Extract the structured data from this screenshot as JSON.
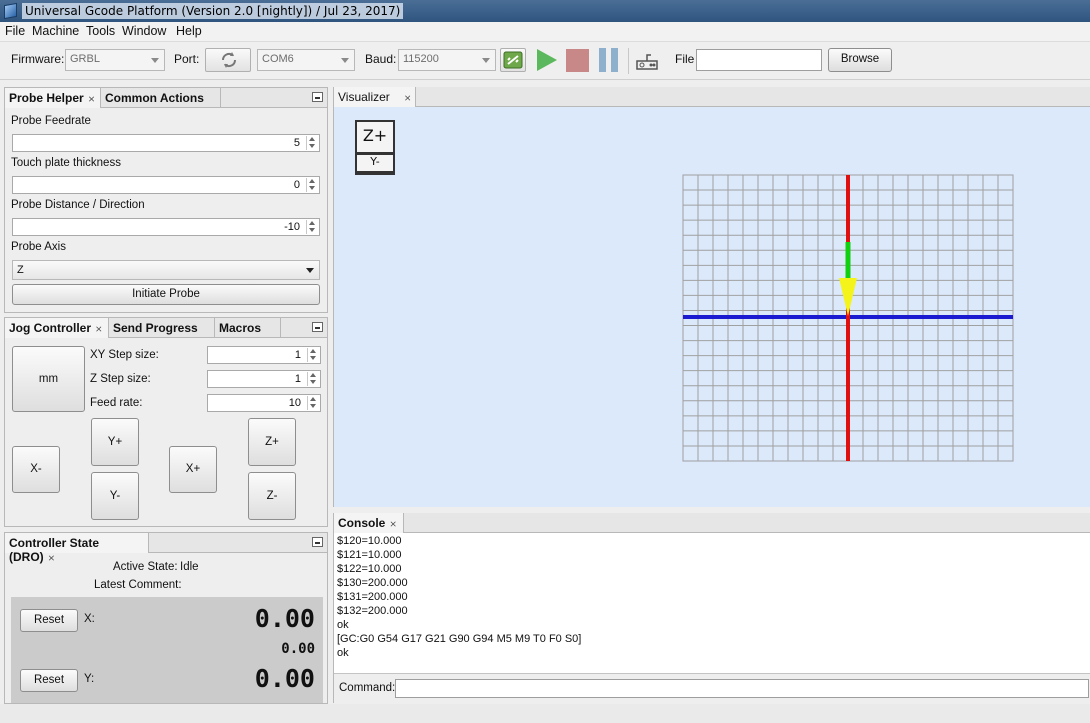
{
  "window": {
    "title": "Universal Gcode Platform (Version 2.0 [nightly])  / Jul 23, 2017)"
  },
  "menu": [
    "File",
    "Machine",
    "Tools",
    "Window",
    "Help"
  ],
  "toolbar": {
    "firmware_label": "Firmware:",
    "firmware_value": "GRBL",
    "port_label": "Port:",
    "port_value": "COM6",
    "baud_label": "Baud:",
    "baud_value": "115200",
    "file_label": "File",
    "file_value": "",
    "browse_label": "Browse",
    "colors": {
      "play": "#5cb85c",
      "stop": "#c98888",
      "pause": "#8fb0cc"
    }
  },
  "probe": {
    "tabs": [
      "Probe Helper",
      "Common Actions"
    ],
    "feedrate_label": "Probe Feedrate",
    "feedrate_value": "5",
    "thickness_label": "Touch plate thickness",
    "thickness_value": "0",
    "distance_label": "Probe Distance / Direction",
    "distance_value": "-10",
    "axis_label": "Probe Axis",
    "axis_value": "Z",
    "initiate_label": "Initiate Probe"
  },
  "jog": {
    "tabs": [
      "Jog Controller",
      "Send Progress",
      "Macros"
    ],
    "unit_label": "mm",
    "xy_label": "XY Step size:",
    "xy_value": "1",
    "z_label": "Z Step size:",
    "z_value": "1",
    "feed_label": "Feed rate:",
    "feed_value": "10",
    "buttons": {
      "xminus": "X-",
      "yplus": "Y+",
      "yminus": "Y-",
      "xplus": "X+",
      "zplus": "Z+",
      "zminus": "Z-"
    }
  },
  "dro": {
    "title": "Controller State (DRO)",
    "state_label": "Active State:",
    "state_value": "Idle",
    "comment_label": "Latest Comment:",
    "reset_label": "Reset",
    "x_label": "X:",
    "x_work": "0.00",
    "x_machine": "0.00",
    "y_label": "Y:",
    "y_work": "0.00"
  },
  "visualizer": {
    "tab": "Visualizer",
    "cube_top": "Z+",
    "cube_front": "Y-",
    "colors": {
      "background": "#dbe9fb",
      "x_axis": "#1a1ad0",
      "y_axis": "#e01010",
      "z_axis": "#10d010",
      "tool": "#f4f41a"
    }
  },
  "console": {
    "tab": "Console",
    "lines": [
      "$120=10.000",
      "$121=10.000",
      "$122=10.000",
      "$130=200.000",
      "$131=200.000",
      "$132=200.000",
      "ok",
      "[GC:G0 G54 G17 G21 G90 G94 M5 M9 T0 F0 S0]",
      "ok"
    ],
    "command_label": "Command:",
    "command_value": ""
  }
}
